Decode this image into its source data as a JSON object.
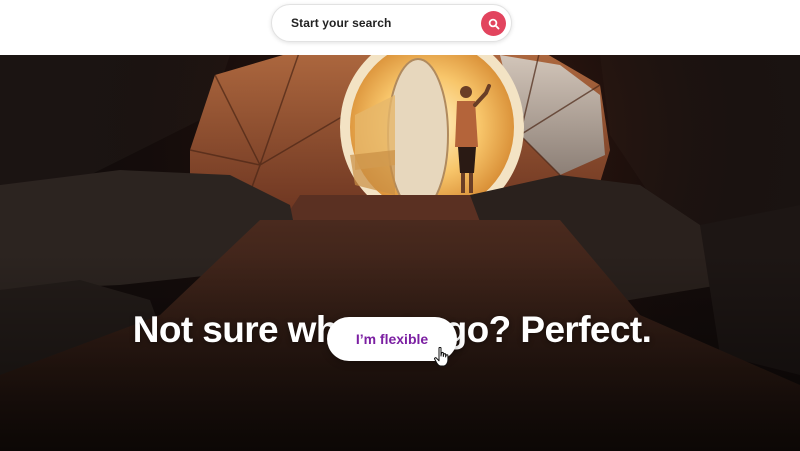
{
  "header": {
    "search": {
      "label": "Start your search",
      "button_icon": "search-icon"
    }
  },
  "hero": {
    "image_description_icon": "glamping-dome-tent-photo",
    "title": "Not sure where to go? Perfect.",
    "cta_label": "I’m flexible"
  },
  "colors": {
    "brand": "#e2445e",
    "cta_text": "#7b1fa2",
    "header_bg": "#ffffff"
  }
}
